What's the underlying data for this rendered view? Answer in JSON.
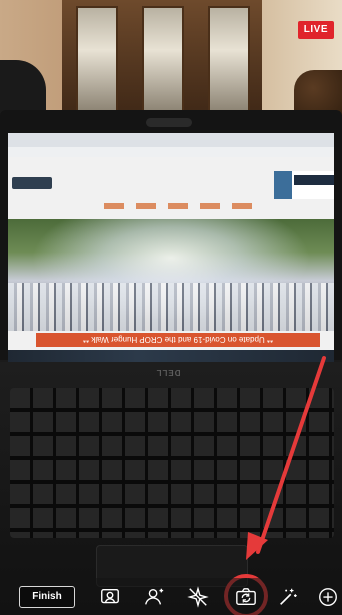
{
  "stream": {
    "live_label": "LIVE"
  },
  "webpage": {
    "banner_text": "** Update on Covid-19 and the CROP Hunger Walk **"
  },
  "laptop": {
    "brand": "DELL"
  },
  "toolbar": {
    "finish_label": "Finish",
    "icons": [
      "people-icon",
      "person-icon",
      "sparkle-off-icon",
      "flip-camera-icon",
      "magic-wand-icon",
      "add-circle-icon"
    ]
  },
  "colors": {
    "live": "#e0242b",
    "annotation": "#e53a3a",
    "toolbar_icon": "#ffffff"
  }
}
